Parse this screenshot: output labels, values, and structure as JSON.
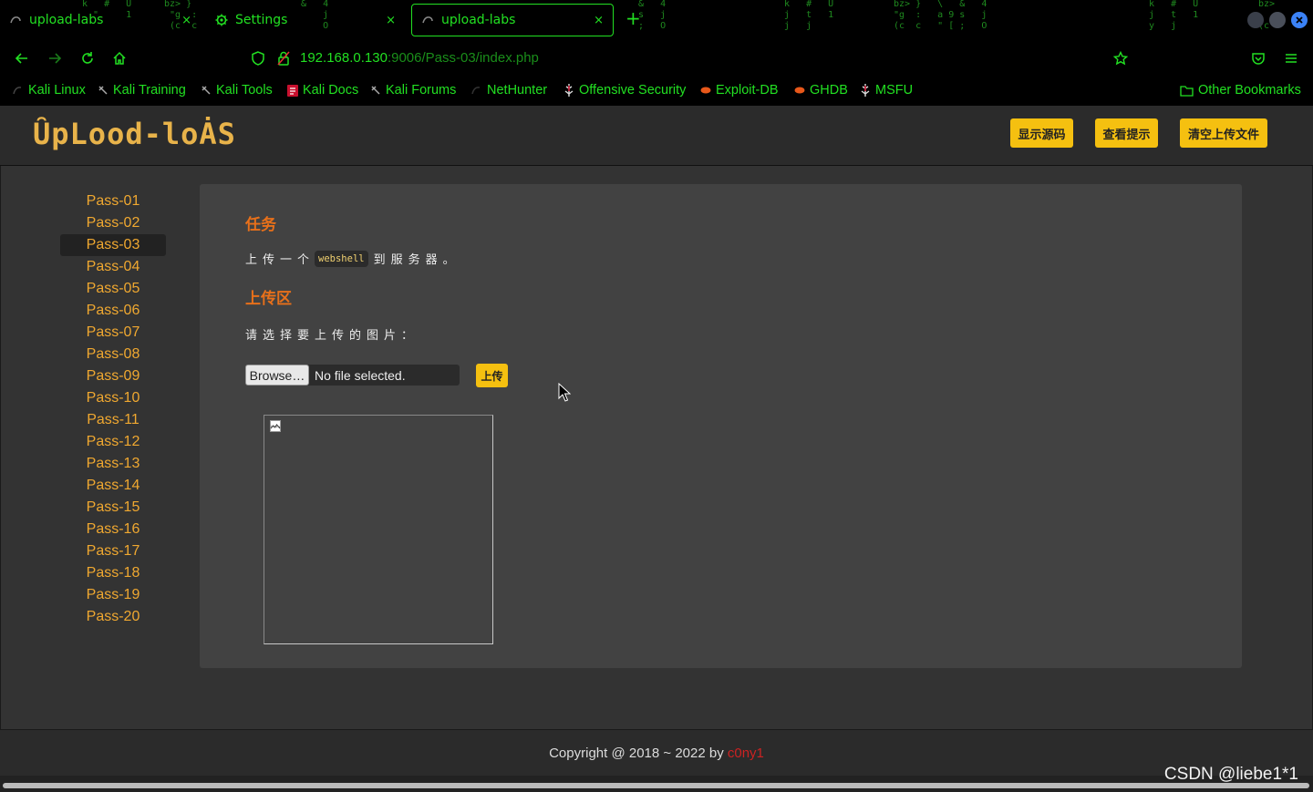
{
  "browser": {
    "tabs": [
      {
        "label": "upload-labs",
        "close": "×",
        "active": false
      },
      {
        "label": "Settings",
        "close": "×",
        "active": false
      },
      {
        "label": "upload-labs",
        "close": "×",
        "active": true
      }
    ],
    "new_tab": "+",
    "address": {
      "host": "192.168.0.130",
      "path": ":9006/Pass-03/index.php"
    },
    "bookmarks": [
      "Kali Linux",
      "Kali Training",
      "Kali Tools",
      "Kali Docs",
      "Kali Forums",
      "NetHunter",
      "Offensive Security",
      "Exploit-DB",
      "GHDB",
      "MSFU"
    ],
    "other_bookmarks": "Other Bookmarks",
    "accent": "#22e022"
  },
  "page": {
    "logo": "ȖpLood-loȦS",
    "header_buttons": [
      "显示源码",
      "查看提示",
      "清空上传文件"
    ],
    "sidebar": [
      "Pass-01",
      "Pass-02",
      "Pass-03",
      "Pass-04",
      "Pass-05",
      "Pass-06",
      "Pass-07",
      "Pass-08",
      "Pass-09",
      "Pass-10",
      "Pass-11",
      "Pass-12",
      "Pass-13",
      "Pass-14",
      "Pass-15",
      "Pass-16",
      "Pass-17",
      "Pass-18",
      "Pass-19",
      "Pass-20"
    ],
    "active_item": "Pass-03",
    "task_title": "任务",
    "task_text_before": "上传一个",
    "task_code": "webshell",
    "task_text_after": "到服务器。",
    "upload_title": "上传区",
    "upload_prompt": "请选择要上传的图片：",
    "browse_label": "Browse…",
    "file_status": "No file selected.",
    "upload_button": "上传",
    "footer_text": "Copyright @ 2018 ~ 2022 by ",
    "footer_author": "c0ny1",
    "watermark": "CSDN @liebe1*1",
    "colors": {
      "button": "#f5c010",
      "heading": "#e8701a",
      "link": "#f0a830"
    }
  }
}
